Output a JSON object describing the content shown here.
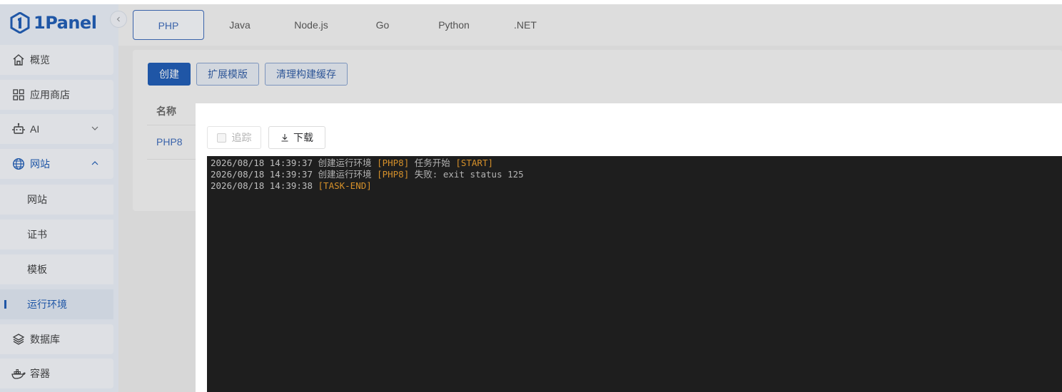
{
  "app": {
    "logo_text": "1Panel",
    "brand_color": "#0b4fb0"
  },
  "sidebar": {
    "items": [
      {
        "label": "概览",
        "icon": "home-icon"
      },
      {
        "label": "应用商店",
        "icon": "apps-grid-icon"
      },
      {
        "label": "AI",
        "icon": "robot-icon",
        "expandable": true,
        "expanded": false
      },
      {
        "label": "网站",
        "icon": "globe-icon",
        "expandable": true,
        "expanded": true
      },
      {
        "label": "数据库",
        "icon": "layers-icon"
      },
      {
        "label": "容器",
        "icon": "docker-icon"
      }
    ],
    "website_sub_items": [
      {
        "label": "网站"
      },
      {
        "label": "证书"
      },
      {
        "label": "模板"
      },
      {
        "label": "运行环境",
        "current": true
      }
    ]
  },
  "runtime_tabs": [
    {
      "label": "PHP",
      "active": true
    },
    {
      "label": "Java"
    },
    {
      "label": "Node.js"
    },
    {
      "label": "Go"
    },
    {
      "label": "Python"
    },
    {
      "label": ".NET"
    }
  ],
  "toolbar": {
    "create_label": "创建",
    "ext_template_label": "扩展模版",
    "clear_cache_label": "清理构建缓存"
  },
  "table": {
    "headers": [
      "名称"
    ],
    "rows": [
      {
        "name": "PHP8"
      }
    ]
  },
  "log_dialog": {
    "follow_label": "追踪",
    "follow_checked": false,
    "download_label": "下载",
    "lines": [
      {
        "timestamp": "2026/08/18 14:39:37",
        "action": "创建运行环境",
        "target": "[PHP8]",
        "message": "任务开始",
        "status": "[START]"
      },
      {
        "timestamp": "2026/08/18 14:39:37",
        "action": "创建运行环境",
        "target": "[PHP8]",
        "message": "失败: exit status 125",
        "status": ""
      },
      {
        "timestamp": "2026/08/18 14:39:38",
        "action": "",
        "target": "",
        "message": "",
        "status": "[TASK-END]"
      }
    ]
  }
}
